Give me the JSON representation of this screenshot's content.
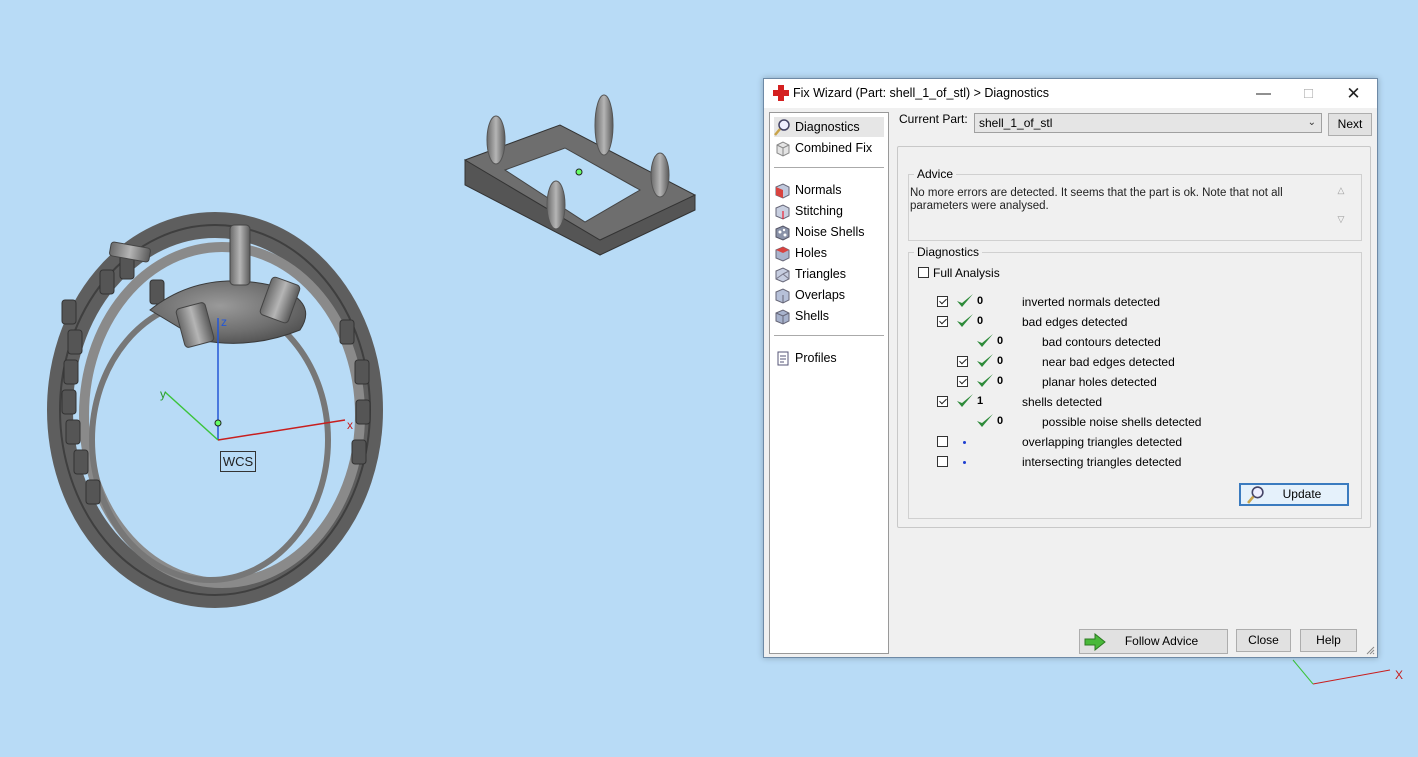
{
  "viewport": {
    "wcs_label": "WCS",
    "axis_x": "x",
    "axis_y": "y",
    "axis_z": "z",
    "axis_x2": "X"
  },
  "dialog": {
    "title": "Fix Wizard (Part: shell_1_of_stl) > Diagnostics",
    "controls": {
      "minimize": "—",
      "maximize": "□",
      "close": "✕"
    },
    "sidebar": {
      "top_items": [
        {
          "label": "Diagnostics",
          "icon": "magnifier-icon",
          "active": true
        },
        {
          "label": "Combined Fix",
          "icon": "combined-fix-icon"
        }
      ],
      "tool_items": [
        {
          "label": "Normals",
          "icon": "normals-icon"
        },
        {
          "label": "Stitching",
          "icon": "stitching-icon"
        },
        {
          "label": "Noise Shells",
          "icon": "noise-shells-icon"
        },
        {
          "label": "Holes",
          "icon": "holes-icon"
        },
        {
          "label": "Triangles",
          "icon": "triangles-icon"
        },
        {
          "label": "Overlaps",
          "icon": "overlaps-icon"
        },
        {
          "label": "Shells",
          "icon": "shells-icon"
        }
      ],
      "bottom_items": [
        {
          "label": "Profiles",
          "icon": "profiles-icon"
        }
      ]
    },
    "current_part_label": "Current Part:",
    "current_part_value": "shell_1_of_stl",
    "next_label": "Next",
    "advice": {
      "legend": "Advice",
      "text": "No more errors are detected. It seems that the part is ok. Note that not all parameters were analysed."
    },
    "diagnostics": {
      "legend": "Diagnostics",
      "full_analysis_label": "Full Analysis",
      "full_analysis_checked": false,
      "rows": [
        {
          "checkbox": true,
          "checked": true,
          "indent": 0,
          "status": "ok",
          "count": "0",
          "label": "inverted normals detected"
        },
        {
          "checkbox": true,
          "checked": true,
          "indent": 0,
          "status": "ok",
          "count": "0",
          "label": "bad edges detected"
        },
        {
          "checkbox": false,
          "checked": false,
          "indent": 1,
          "status": "ok",
          "count": "0",
          "label": "bad contours detected"
        },
        {
          "checkbox": true,
          "checked": true,
          "indent": 1,
          "status": "ok",
          "count": "0",
          "label": "near bad edges detected"
        },
        {
          "checkbox": true,
          "checked": true,
          "indent": 1,
          "status": "ok",
          "count": "0",
          "label": "planar holes detected"
        },
        {
          "checkbox": true,
          "checked": true,
          "indent": 0,
          "status": "ok",
          "count": "1",
          "label": "shells detected"
        },
        {
          "checkbox": false,
          "checked": false,
          "indent": 1,
          "status": "ok",
          "count": "0",
          "label": "possible noise shells detected"
        },
        {
          "checkbox": true,
          "checked": false,
          "indent": 0,
          "status": "dot",
          "count": "",
          "label": "overlapping triangles detected"
        },
        {
          "checkbox": true,
          "checked": false,
          "indent": 0,
          "status": "dot",
          "count": "",
          "label": "intersecting triangles detected"
        }
      ],
      "update_label": "Update"
    },
    "footer": {
      "follow_advice": "Follow Advice",
      "close": "Close",
      "help": "Help"
    }
  },
  "colors": {
    "background": "#b8dbf6",
    "ok_tick": "#2e8b3a",
    "dialog_bg": "#f0f0f0"
  }
}
